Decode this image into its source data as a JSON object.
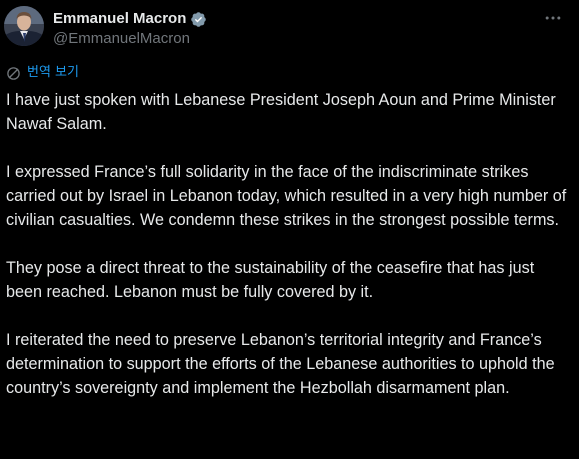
{
  "author": {
    "display_name": "Emmanuel Macron",
    "handle": "@EmmanuelMacron",
    "verified": true,
    "avatar_icon": "profile-photo",
    "verified_icon": "verified-badge-icon",
    "verified_color": "#829aab"
  },
  "actions": {
    "more_icon": "more-options-icon"
  },
  "translate": {
    "icon": "translate-icon",
    "label": "번역 보기",
    "color": "#1d9bf0"
  },
  "tweet": {
    "paragraphs": [
      "I have just spoken with Lebanese President Joseph Aoun and Prime Minister Nawaf Salam.",
      "I expressed France’s full solidarity in the face of the indiscriminate strikes carried out by Israel in Lebanon today, which resulted in a very high number of civilian casualties. We condemn these strikes in the strongest possible terms.",
      "They pose a direct threat to the sustainability of the ceasefire that has just been reached. Lebanon must be fully covered by it.",
      "I reiterated the need to preserve Lebanon’s territorial integrity and France’s determination to support the efforts of the Lebanese authorities to uphold the country’s sovereignty and implement the Hezbollah disarmament plan."
    ]
  },
  "colors": {
    "background": "#000000",
    "primary_text": "#e7e9ea",
    "secondary_text": "#71767b",
    "link": "#1d9bf0"
  }
}
